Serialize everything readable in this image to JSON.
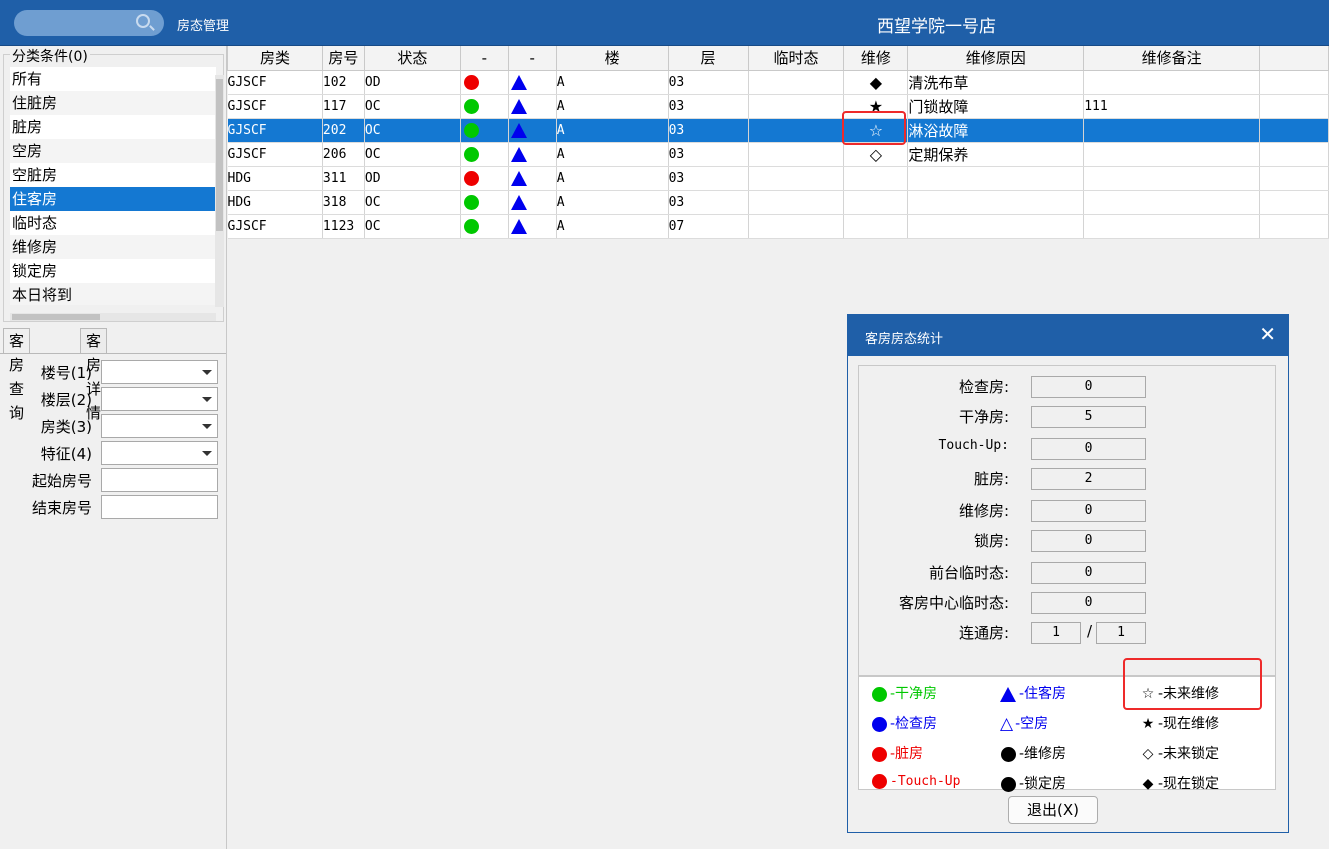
{
  "header": {
    "app_title": "房态管理",
    "hotel_name": "西望学院一号店"
  },
  "category": {
    "legend": "分类条件(0)",
    "items": [
      "所有",
      "住脏房",
      "脏房",
      "空房",
      "空脏房",
      "住客房",
      "临时态",
      "维修房",
      "锁定房",
      "本日将到"
    ],
    "selected": "住客房"
  },
  "tabs": [
    "客房查询",
    "客房详情"
  ],
  "query_form": {
    "building": "楼号(1)",
    "floor": "楼层(2)",
    "room_type": "房类(3)",
    "feature": "特征(4)",
    "start_room": "起始房号",
    "end_room": "结束房号"
  },
  "grid": {
    "columns": [
      "房类",
      "房号",
      "状态",
      "-",
      "-",
      "楼",
      "层",
      "临时态",
      "维修",
      "维修原因",
      "维修备注",
      ""
    ],
    "rows": [
      {
        "type": "GJSCF",
        "room": "102",
        "status": "OD",
        "dot": "red",
        "building": "A",
        "floor": "03",
        "temp": "",
        "maint": "◆",
        "reason": "清洗布草",
        "note": ""
      },
      {
        "type": "GJSCF",
        "room": "117",
        "status": "OC",
        "dot": "green",
        "building": "A",
        "floor": "03",
        "temp": "",
        "maint": "★",
        "reason": "门锁故障",
        "note": "111"
      },
      {
        "type": "GJSCF",
        "room": "202",
        "status": "OC",
        "dot": "green",
        "building": "A",
        "floor": "03",
        "temp": "",
        "maint": "☆",
        "reason": "淋浴故障",
        "note": ""
      },
      {
        "type": "GJSCF",
        "room": "206",
        "status": "OC",
        "dot": "green",
        "building": "A",
        "floor": "03",
        "temp": "",
        "maint": "◇",
        "reason": "定期保养",
        "note": ""
      },
      {
        "type": "HDG",
        "room": "311",
        "status": "OD",
        "dot": "red",
        "building": "A",
        "floor": "03",
        "temp": "",
        "maint": "",
        "reason": "",
        "note": ""
      },
      {
        "type": "HDG",
        "room": "318",
        "status": "OC",
        "dot": "green",
        "building": "A",
        "floor": "03",
        "temp": "",
        "maint": "",
        "reason": "",
        "note": ""
      },
      {
        "type": "GJSCF",
        "room": "1123",
        "status": "OC",
        "dot": "green",
        "building": "A",
        "floor": "07",
        "temp": "",
        "maint": "",
        "reason": "",
        "note": ""
      }
    ],
    "selected_row": 2
  },
  "dialog": {
    "title": "客房房态统计",
    "close": "✕",
    "stats": [
      {
        "label": "检查房:",
        "value": "0"
      },
      {
        "label": "干净房:",
        "value": "5"
      },
      {
        "label": "Touch-Up:",
        "value": "0"
      },
      {
        "label": "脏房:",
        "value": "2"
      },
      {
        "label": "维修房:",
        "value": "0"
      },
      {
        "label": "锁房:",
        "value": "0"
      },
      {
        "label": "前台临时态:",
        "value": "0"
      },
      {
        "label": "客房中心临时态:",
        "value": "0"
      }
    ],
    "connecting": {
      "label": "连通房:",
      "value1": "1",
      "sep": "/",
      "value2": "1"
    },
    "legend": [
      {
        "sym": "-干净房",
        "color": "#00c800"
      },
      {
        "sym": "-住客房",
        "color": "#0000ee"
      },
      {
        "sym": "-未来维修",
        "color": "#000000"
      },
      {
        "sym": "-检查房",
        "color": "#0000ee"
      },
      {
        "sym": "-空房",
        "color": "#0000ee"
      },
      {
        "sym": "-现在维修",
        "color": "#000000"
      },
      {
        "sym": "-脏房",
        "color": "#ee0000"
      },
      {
        "sym": "-维修房",
        "color": "#000000"
      },
      {
        "sym": "-未来锁定",
        "color": "#000000"
      },
      {
        "sym": "-Touch-Up",
        "color": "#ee0000"
      },
      {
        "sym": "-锁定房",
        "color": "#000000"
      },
      {
        "sym": "-现在锁定",
        "color": "#000000"
      }
    ],
    "exit_label": "退出(X)"
  },
  "colors": {
    "accent": "#1f5fa8",
    "selection": "#1478d2",
    "highlight": "#ee2a2a",
    "green": "#00c800",
    "red": "#ee0000",
    "blue": "#0000ee"
  }
}
